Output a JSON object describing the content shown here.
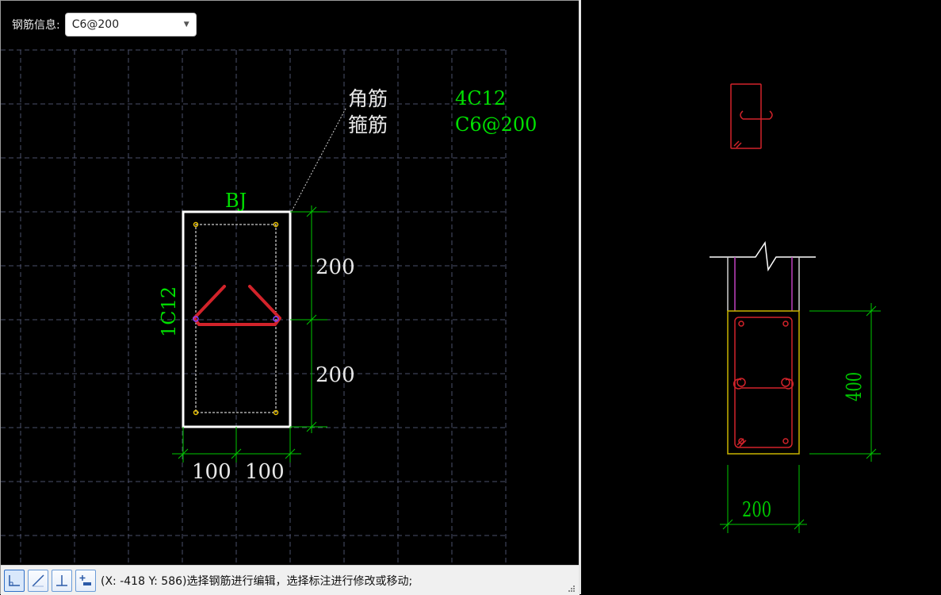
{
  "rebar_info": {
    "label": "钢筋信息:",
    "selected": "C6@200"
  },
  "section_drawing": {
    "corner_label": "角筋",
    "corner_value": "4C12",
    "stirrup_label": "箍筋",
    "stirrup_value": "C6@200",
    "member_name": "BJ",
    "side_bar_label": "1C12",
    "dim_height_top": "200",
    "dim_height_bottom": "200",
    "dim_width_left": "100",
    "dim_width_right": "100"
  },
  "preview": {
    "dim_height": "400",
    "dim_width": "200"
  },
  "status_bar": {
    "coords": "(X: -418 Y: 586)",
    "message": "选择钢筋进行编辑，选择标注进行修改或移动;",
    "tools": [
      "orthogonal-corner-icon",
      "diagonal-line-icon",
      "perpendicular-icon",
      "add-dimension-icon"
    ]
  },
  "colors": {
    "canvas": "#000000",
    "grid": "#4a4f6a",
    "outline": "#ffffff",
    "rebar": "#d2232a",
    "dimension": "#00c800",
    "label_green": "#00e000",
    "label_white": "#e8e8e8",
    "concrete_edge": "#c8b400",
    "magenta": "#c040c0"
  }
}
